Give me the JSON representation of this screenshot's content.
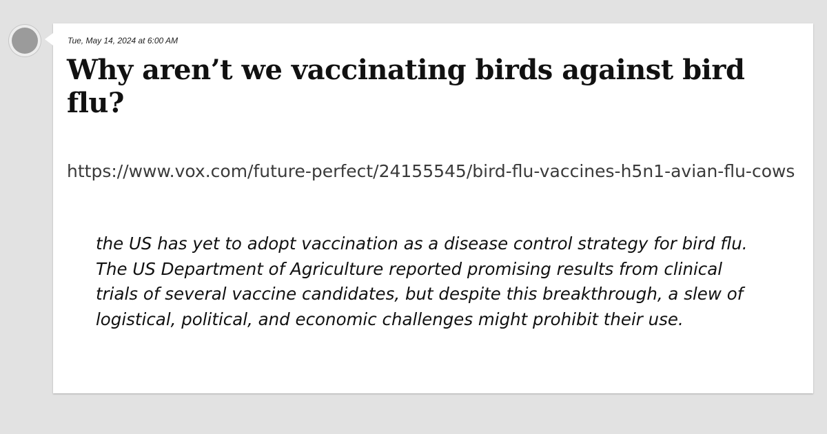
{
  "post": {
    "timestamp": "Tue, May 14, 2024 at 6:00 AM",
    "title": "Why aren’t we vaccinating birds against bird flu?",
    "url": "https://www.vox.com/future-perfect/24155545/bird-flu-vaccines-h5n1-avian-flu-cows",
    "quote": "the US has yet to adopt vaccination as a disease control strategy for bird flu. The US Department of Agriculture reported promising results from clinical trials of several vaccine candidates, but despite this breakthrough, a slew of logistical, political, and economic challenges might prohibit their use."
  },
  "colors": {
    "background": "#e2e2e2",
    "card": "#ffffff",
    "avatar": "#9b9b9b"
  }
}
